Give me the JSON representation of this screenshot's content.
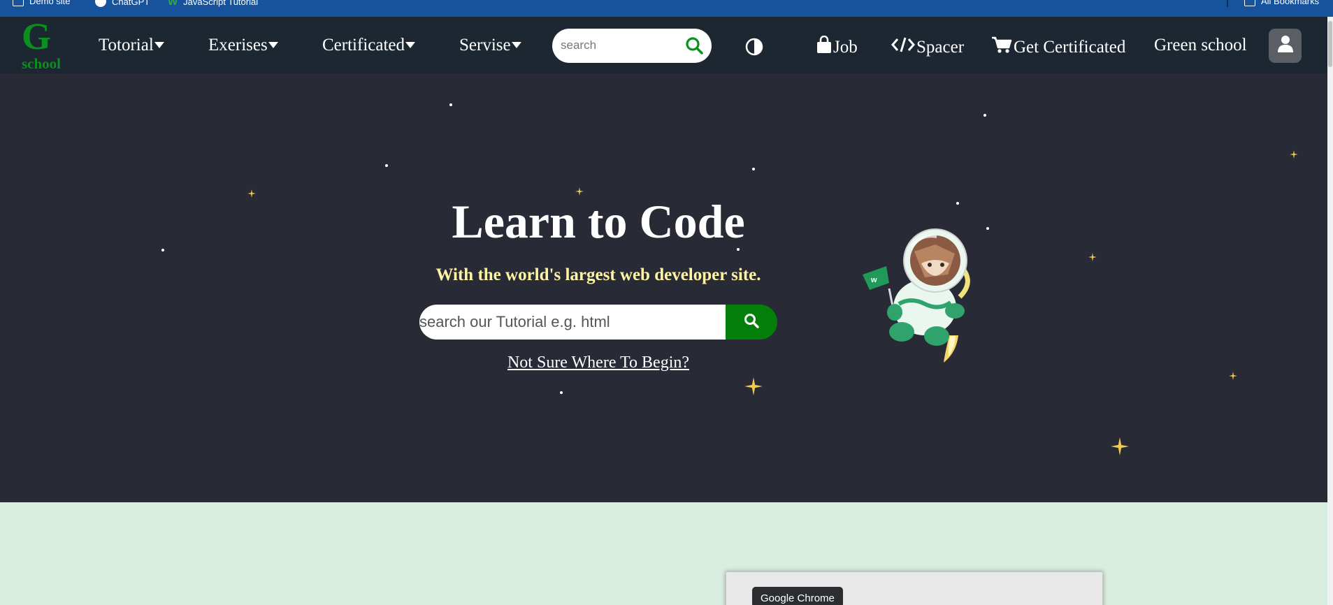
{
  "bookmarks": {
    "items": [
      {
        "label": "Demo site",
        "icon": "folder-icon"
      },
      {
        "label": "ChatGPT",
        "icon": "chatgpt-icon"
      },
      {
        "label": "JavaScript Tutorial",
        "icon": "w3-icon"
      }
    ],
    "all_bookmarks": "All Bookmarks"
  },
  "nav": {
    "logo_letter": "G",
    "logo_word": "school",
    "menus": [
      "Totorial",
      "Exerises",
      "Certificated",
      "Servise"
    ],
    "search_placeholder": "search",
    "job": "Job",
    "spacer": "Spacer",
    "get_certificated": "Get Certificated",
    "green_school": "Green school"
  },
  "hero": {
    "title": "Learn to Code",
    "subtitle": "With the world's largest web developer site.",
    "search_placeholder": "search our Tutorial e.g. html",
    "begin_link": "Not Sure Where To Begin?"
  },
  "tooltip": "Google Chrome",
  "colors": {
    "bookmarks_bg": "#17539d",
    "nav_bg": "#1d2732",
    "hero_bg": "#282a35",
    "accent_green": "#04800a",
    "subtitle_yellow": "#fff4a3",
    "lower_bg": "#d9ede0"
  }
}
